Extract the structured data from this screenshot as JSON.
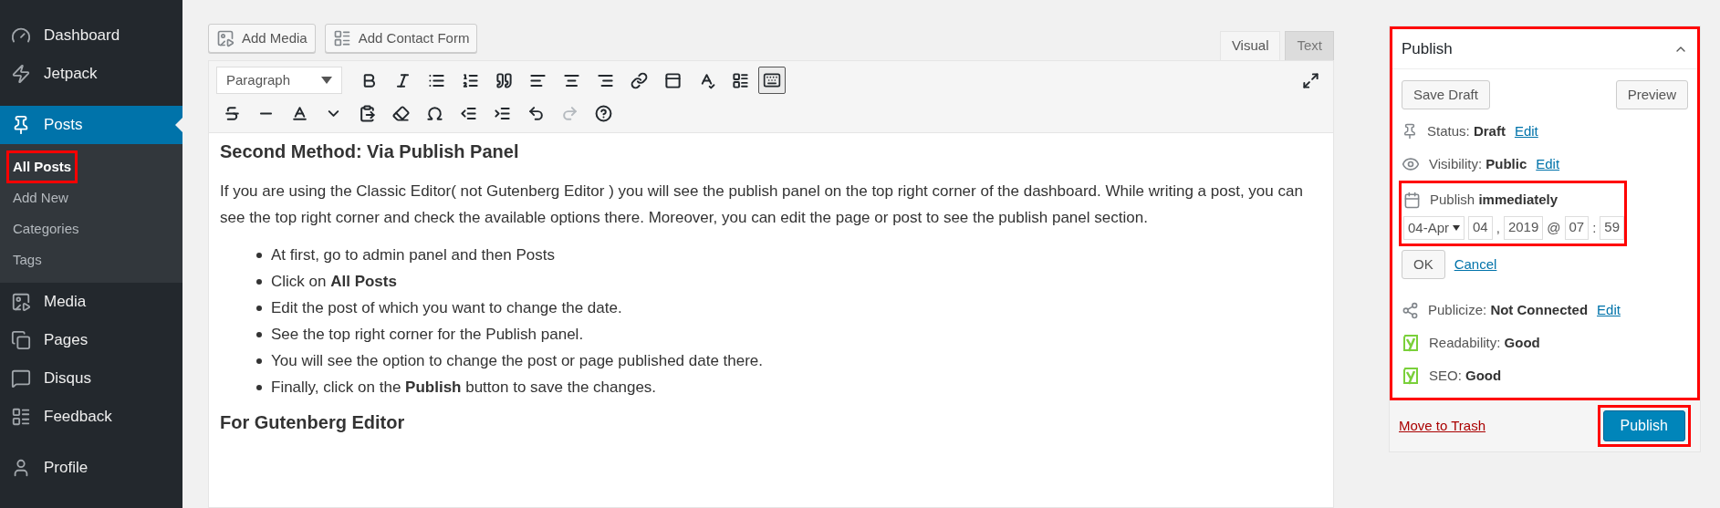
{
  "sidebar": {
    "items": [
      {
        "label": "Dashboard",
        "selected": false
      },
      {
        "label": "Jetpack",
        "selected": false
      },
      {
        "label": "Posts",
        "selected": true,
        "children": [
          {
            "label": "All Posts",
            "selected": true,
            "highlighted": true
          },
          {
            "label": "Add New",
            "selected": false
          },
          {
            "label": "Categories",
            "selected": false
          },
          {
            "label": "Tags",
            "selected": false
          }
        ]
      },
      {
        "label": "Media",
        "selected": false
      },
      {
        "label": "Pages",
        "selected": false
      },
      {
        "label": "Disqus",
        "selected": false
      },
      {
        "label": "Feedback",
        "selected": false
      },
      {
        "label": "Profile",
        "selected": false
      }
    ]
  },
  "media_buttons": [
    {
      "label": "Add Media"
    },
    {
      "label": "Add Contact Form"
    }
  ],
  "editor_tabs": [
    {
      "label": "Visual",
      "selected": true
    },
    {
      "label": "Text",
      "selected": false
    }
  ],
  "toolbar": {
    "format": "Paragraph",
    "toggle_pressed": true
  },
  "content": {
    "heading": "Second Method: Via Publish Panel",
    "paragraph": "If you are using the Classic Editor( not Gutenberg Editor ) you will see the publish panel on the top right corner of the dashboard. While writing a post, you can see the top right corner and check the available options there. Moreover, you can edit the page or post to see the publish panel section.",
    "bullets": [
      "At first, go to admin panel and then Posts",
      "Click on **All Posts**",
      "Edit the post of which you want to change the date.",
      "See the top right corner for the Publish panel.",
      "You will see the option to change the post or page published date there.",
      "Finally, click on the **Publish** button to save the changes."
    ],
    "subheading": "For Gutenberg Editor"
  },
  "publish_panel": {
    "title": "Publish",
    "save_draft": "Save Draft",
    "preview": "Preview",
    "status": {
      "label": "Status:",
      "value": "Draft",
      "link": "Edit"
    },
    "visibility": {
      "label": "Visibility:",
      "value": "Public",
      "link": "Edit"
    },
    "schedule": {
      "label": "Publish",
      "value": "immediately",
      "month": "04-Apr",
      "day": "04",
      "year": "2019",
      "hour": "07",
      "minute": "59",
      "date_separator": ",",
      "at": "@",
      "time_separator": ":",
      "ok": "OK",
      "cancel": "Cancel"
    },
    "publicize": {
      "label": "Publicize:",
      "value": "Not Connected",
      "link": "Edit"
    },
    "readability": {
      "label": "Readability:",
      "value": "Good"
    },
    "seo": {
      "label": "SEO:",
      "value": "Good"
    },
    "trash": "Move to Trash",
    "publish": "Publish"
  }
}
